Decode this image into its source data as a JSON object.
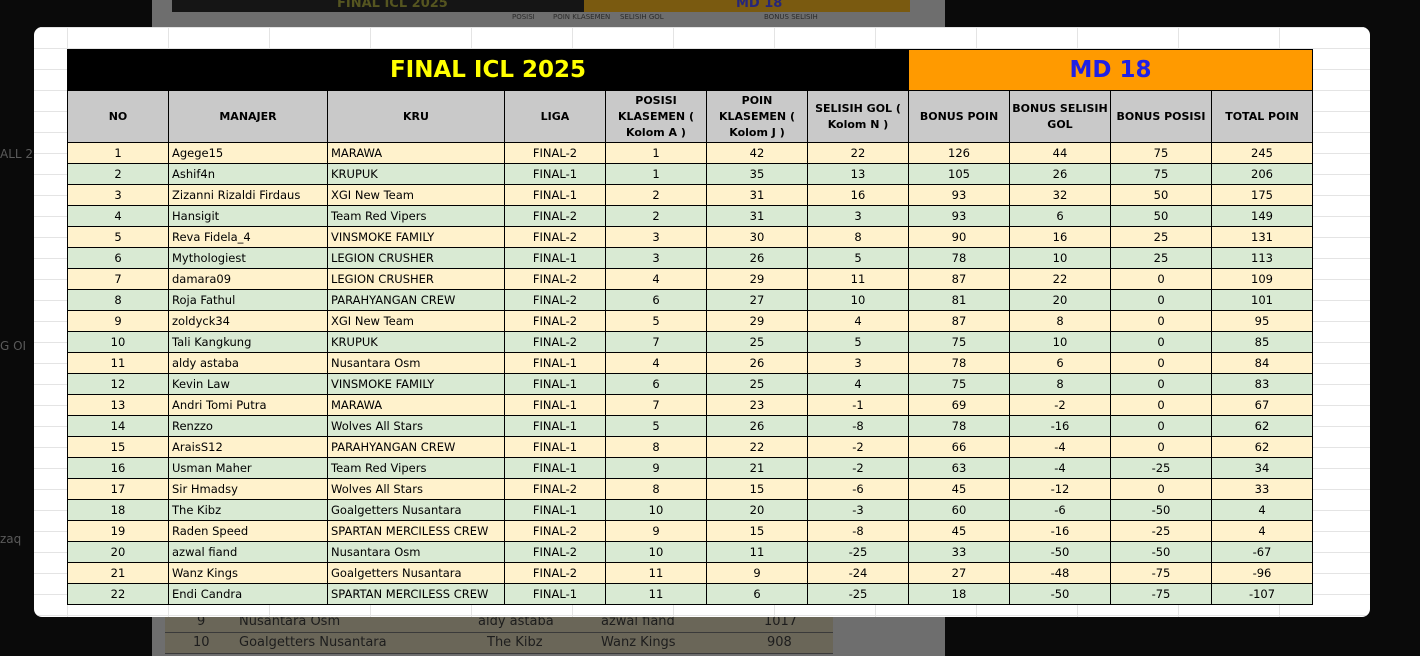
{
  "background_sheet": {
    "title": "FINAL ICL 2025",
    "md": "MD 18",
    "header_fragments": [
      "POSISI",
      "POIN KLASEMEN",
      "SELISIH GOL",
      "BONUS SELISIH"
    ],
    "left_fragments": [
      "ALL 2",
      "G OI",
      "zaq"
    ],
    "bottom_rows": [
      {
        "no": "9",
        "team": "Nusantara Osm",
        "a": "aldy astaba",
        "b": "azwal fiand",
        "score": "1017"
      },
      {
        "no": "10",
        "team": "Goalgetters Nusantara",
        "a": "The Kibz",
        "b": "Wanz Kings",
        "score": "908"
      }
    ]
  },
  "table": {
    "title": "FINAL ICL 2025",
    "md_label": "MD 18",
    "headers": [
      "NO",
      "MANAJER",
      "KRU",
      "LIGA",
      "POSISI KLASEMEN ( Kolom A )",
      "POIN KLASEMEN ( Kolom J )",
      "SELISIH GOL ( Kolom N )",
      "BONUS POIN",
      "BONUS SELISIH GOL",
      "BONUS POSISI",
      "TOTAL POIN"
    ],
    "rows": [
      [
        "1",
        "Agege15",
        "MARAWA",
        "FINAL-2",
        "1",
        "42",
        "22",
        "126",
        "44",
        "75",
        "245"
      ],
      [
        "2",
        "Ashif4n",
        "KRUPUK",
        "FINAL-1",
        "1",
        "35",
        "13",
        "105",
        "26",
        "75",
        "206"
      ],
      [
        "3",
        "Zizanni Rizaldi Firdaus",
        "XGI New Team",
        "FINAL-1",
        "2",
        "31",
        "16",
        "93",
        "32",
        "50",
        "175"
      ],
      [
        "4",
        "Hansigit",
        "Team Red Vipers",
        "FINAL-2",
        "2",
        "31",
        "3",
        "93",
        "6",
        "50",
        "149"
      ],
      [
        "5",
        "Reva Fidela_4",
        "VINSMOKE FAMILY",
        "FINAL-2",
        "3",
        "30",
        "8",
        "90",
        "16",
        "25",
        "131"
      ],
      [
        "6",
        "Mythologiest",
        "LEGION CRUSHER",
        "FINAL-1",
        "3",
        "26",
        "5",
        "78",
        "10",
        "25",
        "113"
      ],
      [
        "7",
        "damara09",
        "LEGION CRUSHER",
        "FINAL-2",
        "4",
        "29",
        "11",
        "87",
        "22",
        "0",
        "109"
      ],
      [
        "8",
        "Roja Fathul",
        "PARAHYANGAN CREW",
        "FINAL-2",
        "6",
        "27",
        "10",
        "81",
        "20",
        "0",
        "101"
      ],
      [
        "9",
        "zoldyck34",
        "XGI New Team",
        "FINAL-2",
        "5",
        "29",
        "4",
        "87",
        "8",
        "0",
        "95"
      ],
      [
        "10",
        "Tali Kangkung",
        "KRUPUK",
        "FINAL-2",
        "7",
        "25",
        "5",
        "75",
        "10",
        "0",
        "85"
      ],
      [
        "11",
        "aldy astaba",
        "Nusantara Osm",
        "FINAL-1",
        "4",
        "26",
        "3",
        "78",
        "6",
        "0",
        "84"
      ],
      [
        "12",
        "Kevin Law",
        "VINSMOKE FAMILY",
        "FINAL-1",
        "6",
        "25",
        "4",
        "75",
        "8",
        "0",
        "83"
      ],
      [
        "13",
        "Andri Tomi Putra",
        "MARAWA",
        "FINAL-1",
        "7",
        "23",
        "-1",
        "69",
        "-2",
        "0",
        "67"
      ],
      [
        "14",
        "Renzzo",
        "Wolves All Stars",
        "FINAL-1",
        "5",
        "26",
        "-8",
        "78",
        "-16",
        "0",
        "62"
      ],
      [
        "15",
        "AraisS12",
        "PARAHYANGAN CREW",
        "FINAL-1",
        "8",
        "22",
        "-2",
        "66",
        "-4",
        "0",
        "62"
      ],
      [
        "16",
        "Usman Maher",
        "Team Red Vipers",
        "FINAL-1",
        "9",
        "21",
        "-2",
        "63",
        "-4",
        "-25",
        "34"
      ],
      [
        "17",
        "Sir Hmadsy",
        "Wolves All Stars",
        "FINAL-2",
        "8",
        "15",
        "-6",
        "45",
        "-12",
        "0",
        "33"
      ],
      [
        "18",
        "The Kibz",
        "Goalgetters Nusantara",
        "FINAL-1",
        "10",
        "20",
        "-3",
        "60",
        "-6",
        "-50",
        "4"
      ],
      [
        "19",
        "Raden Speed",
        "SPARTAN MERCILESS CREW",
        "FINAL-2",
        "9",
        "15",
        "-8",
        "45",
        "-16",
        "-25",
        "4"
      ],
      [
        "20",
        "azwal fiand",
        "Nusantara Osm",
        "FINAL-2",
        "10",
        "11",
        "-25",
        "33",
        "-50",
        "-50",
        "-67"
      ],
      [
        "21",
        "Wanz Kings",
        "Goalgetters Nusantara",
        "FINAL-2",
        "11",
        "9",
        "-24",
        "27",
        "-48",
        "-75",
        "-96"
      ],
      [
        "22",
        "Endi Candra",
        "SPARTAN MERCILESS CREW",
        "FINAL-1",
        "11",
        "6",
        "-25",
        "18",
        "-50",
        "-75",
        "-107"
      ]
    ]
  },
  "colors": {
    "title_bg": "#000000",
    "title_text": "#ffff00",
    "md_bg": "#ff9a00",
    "md_text": "#2020e6",
    "header_bg": "#c9c9c9",
    "row_odd": "#fff2cc",
    "row_even": "#d9ead3"
  }
}
